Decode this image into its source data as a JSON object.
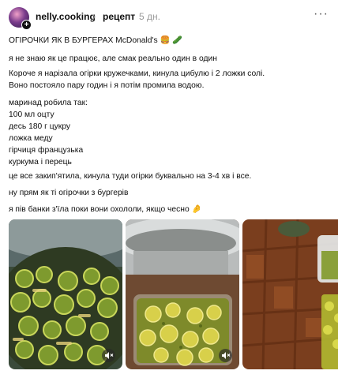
{
  "author": {
    "username": "nelly.cooking",
    "topic": "рецепт",
    "time": "5 дн."
  },
  "post": {
    "title": "ОГІРОЧКИ ЯК В БУРГЕРАХ McDonald's 🍔 🥒",
    "lines": [
      "я не знаю як це працює, але смак реально один в один",
      "Короче я нарізала огірки кружечками, кинула цибулю і 2 ложки солі.",
      "Воно постояло пару годин і я потім промила водою.",
      "маринад робила так:",
      "100 мл оцту",
      "десь 180 г цукру",
      "ложка меду",
      "гірчиця французька",
      "куркума і перець",
      "це все закип'ятила, кинула туди огірки буквально на 3-4 хв і все.",
      "ну прям як ті огірочки з бургерів",
      "я пів банки з'їла поки вони охололи, якщо чесно 🤌"
    ]
  },
  "icons": {
    "chevron": "chevron-right-icon",
    "more": "more-dots-icon",
    "mute": "speaker-muted-icon"
  }
}
